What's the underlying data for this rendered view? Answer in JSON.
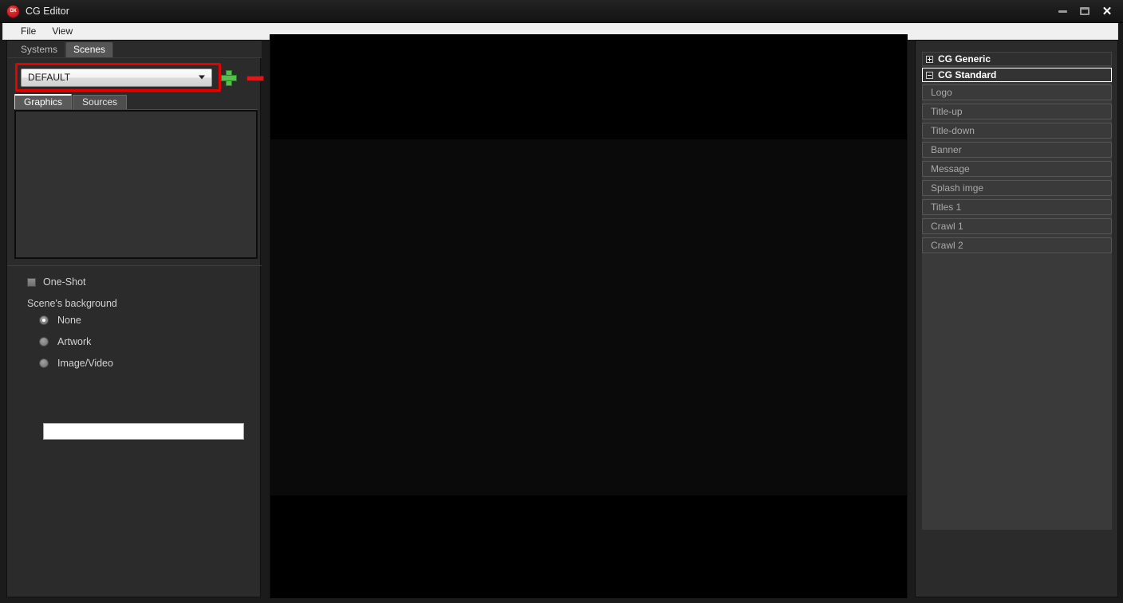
{
  "window": {
    "title": "CG Editor",
    "icon_name": "dx-app-icon",
    "icon_text": "DX",
    "controls": {
      "minimize": "minimize-icon",
      "maximize": "maximize-icon",
      "close": "close-icon"
    }
  },
  "menubar": {
    "items": [
      {
        "label": "File"
      },
      {
        "label": "View"
      }
    ]
  },
  "left_panel": {
    "top_tabs": [
      {
        "label": "Systems",
        "active": false
      },
      {
        "label": "Scenes",
        "active": true
      }
    ],
    "scene_combo": {
      "value": "DEFAULT",
      "arrow_icon": "chevron-down-icon",
      "highlight_color": "#e60000"
    },
    "add_button": {
      "icon": "plus-icon",
      "color": "#55c04e"
    },
    "remove_button": {
      "icon": "minus-icon",
      "color": "#d91a1a"
    },
    "mid_tabs": [
      {
        "label": "Graphics",
        "active": true
      },
      {
        "label": "Sources",
        "active": false
      }
    ],
    "graphics_list": {
      "items": []
    },
    "one_shot": {
      "label": "One-Shot",
      "checked": false
    },
    "background": {
      "section_label": "Scene's background",
      "options": [
        {
          "label": "None",
          "selected": true
        },
        {
          "label": "Artwork",
          "selected": false
        },
        {
          "label": "Image/Video",
          "selected": false
        }
      ],
      "path_value": "",
      "path_placeholder": ""
    }
  },
  "preview": {
    "name": "scene-preview",
    "letterbox_color": "#000000",
    "canvas_color": "#0a0a0a"
  },
  "right_panel": {
    "groups": [
      {
        "label": "CG Generic",
        "expanded": false,
        "selected": false,
        "toggle_icon": "plus-box-icon",
        "items": []
      },
      {
        "label": "CG Standard",
        "expanded": true,
        "selected": true,
        "toggle_icon": "minus-box-icon",
        "items": [
          {
            "label": "Logo"
          },
          {
            "label": "Title-up"
          },
          {
            "label": "Title-down"
          },
          {
            "label": "Banner"
          },
          {
            "label": "Message"
          },
          {
            "label": "Splash imge"
          },
          {
            "label": "Titles 1"
          },
          {
            "label": "Crawl 1"
          },
          {
            "label": "Crawl 2"
          }
        ]
      }
    ]
  }
}
